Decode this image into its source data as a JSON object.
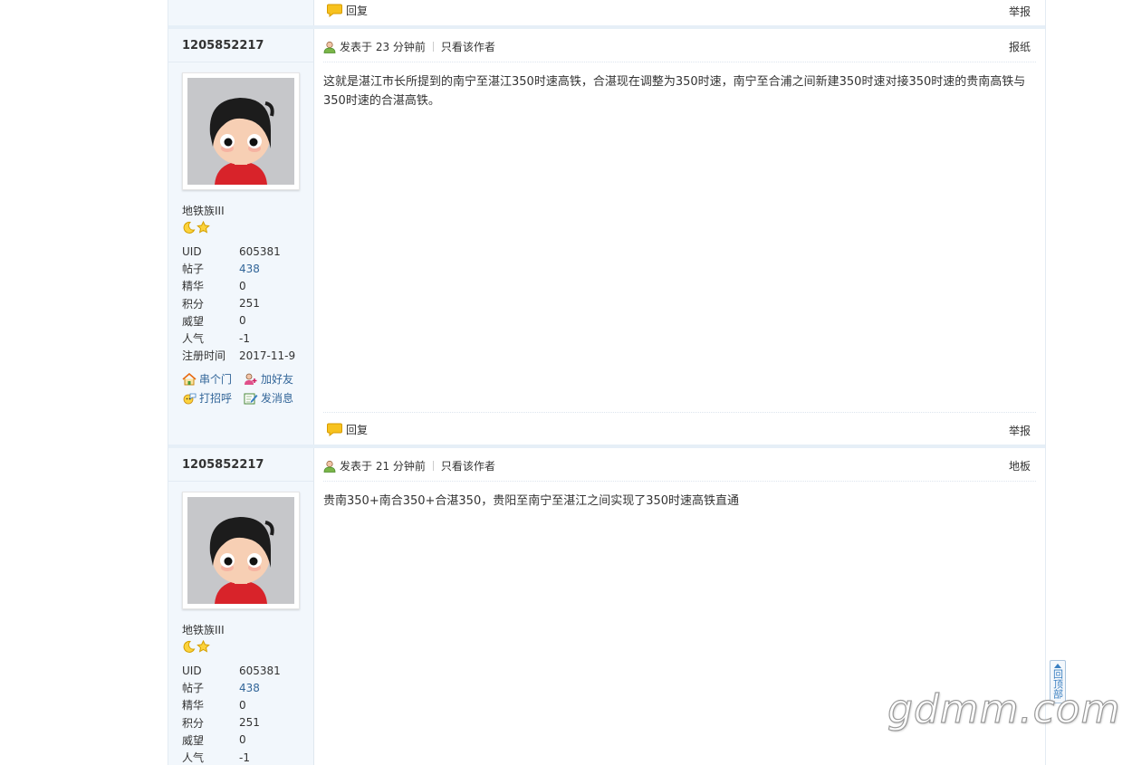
{
  "previous_post_footer": {
    "reply_label": "回复",
    "report_label": "举报"
  },
  "posts": [
    {
      "author": "1205852217",
      "group": "地铁族III",
      "stats": [
        {
          "k": "UID",
          "v": "605381"
        },
        {
          "k": "帖子",
          "v": "438"
        },
        {
          "k": "精华",
          "v": "0"
        },
        {
          "k": "积分",
          "v": "251"
        },
        {
          "k": "威望",
          "v": "0"
        },
        {
          "k": "人气",
          "v": "-1"
        },
        {
          "k": "注册时间",
          "v": "2017-11-9"
        }
      ],
      "actions": [
        "串个门",
        "加好友",
        "打招呼",
        "发消息"
      ],
      "posted": "发表于 23 分钟前",
      "only_author": "只看该作者",
      "floor": "报纸",
      "content": "这就是湛江市长所提到的南宁至湛江350时速高铁，合湛现在调整为350时速，南宁至合浦之间新建350时速对接350时速的贵南高铁与350时速的合湛高铁。",
      "reply_label": "回复",
      "report_label": "举报"
    },
    {
      "author": "1205852217",
      "group": "地铁族III",
      "stats": [
        {
          "k": "UID",
          "v": "605381"
        },
        {
          "k": "帖子",
          "v": "438"
        },
        {
          "k": "精华",
          "v": "0"
        },
        {
          "k": "积分",
          "v": "251"
        },
        {
          "k": "威望",
          "v": "0"
        },
        {
          "k": "人气",
          "v": "-1"
        }
      ],
      "posted": "发表于 21 分钟前",
      "only_author": "只看该作者",
      "floor": "地板",
      "content": "贵南350+南合350+合湛350，贵阳至南宁至湛江之间实现了350时速高铁直通"
    }
  ],
  "back_to_top": "回顶部",
  "watermark": "gdmm.com",
  "icons": {
    "reply": "speech-bubble-icon",
    "poster": "user-icon",
    "rank": [
      "moon-icon",
      "star-icon"
    ],
    "actions": [
      "home-icon",
      "add-friend-icon",
      "wave-icon",
      "compose-icon"
    ]
  }
}
